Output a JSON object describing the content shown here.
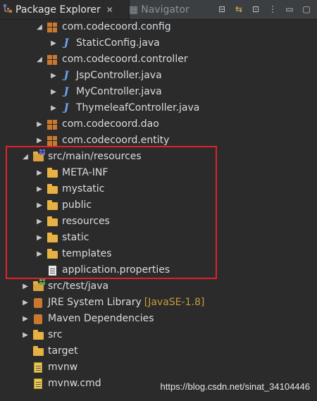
{
  "tabs": {
    "active": {
      "label": "Package Explorer"
    },
    "inactive": {
      "label": "Navigator"
    }
  },
  "toolbar": {
    "buttons": [
      "collapse-all-icon",
      "link-with-editor-icon",
      "focus-icon",
      "view-menu-icon",
      "minimize-icon",
      "maximize-icon"
    ]
  },
  "tree": [
    {
      "label": "com.codecoord.config",
      "type": "package",
      "expanded": true,
      "indent": 2
    },
    {
      "label": "StaticConfig.java",
      "type": "java",
      "expanded": false,
      "indent": 3
    },
    {
      "label": "com.codecoord.controller",
      "type": "package",
      "expanded": true,
      "indent": 2
    },
    {
      "label": "JspController.java",
      "type": "java",
      "expanded": false,
      "indent": 3
    },
    {
      "label": "MyController.java",
      "type": "java",
      "expanded": false,
      "indent": 3
    },
    {
      "label": "ThymeleafController.java",
      "type": "java",
      "expanded": false,
      "indent": 3
    },
    {
      "label": "com.codecoord.dao",
      "type": "package",
      "expanded": false,
      "indent": 2
    },
    {
      "label": "com.codecoord.entity",
      "type": "package",
      "expanded": false,
      "indent": 2
    },
    {
      "label": "src/main/resources",
      "type": "srcfolder",
      "expanded": true,
      "indent": 1
    },
    {
      "label": "META-INF",
      "type": "folder",
      "expanded": false,
      "indent": 2
    },
    {
      "label": "mystatic",
      "type": "folder",
      "expanded": false,
      "indent": 2
    },
    {
      "label": "public",
      "type": "folder",
      "expanded": false,
      "indent": 2
    },
    {
      "label": "resources",
      "type": "folder",
      "expanded": false,
      "indent": 2
    },
    {
      "label": "static",
      "type": "folder",
      "expanded": false,
      "indent": 2
    },
    {
      "label": "templates",
      "type": "folder",
      "expanded": false,
      "indent": 2
    },
    {
      "label": "application.properties",
      "type": "file",
      "expanded": false,
      "indent": 2
    },
    {
      "label": "src/test/java",
      "type": "srcfolder-green",
      "expanded": false,
      "indent": 1
    },
    {
      "label": "JRE System Library",
      "suffix": "[JavaSE-1.8]",
      "type": "library",
      "expanded": false,
      "indent": 1
    },
    {
      "label": "Maven Dependencies",
      "type": "library",
      "expanded": false,
      "indent": 1
    },
    {
      "label": "src",
      "type": "folder",
      "expanded": false,
      "indent": 1
    },
    {
      "label": "target",
      "type": "folder",
      "expanded": false,
      "indent": 1
    },
    {
      "label": "mvnw",
      "type": "textfile",
      "expanded": false,
      "indent": 1
    },
    {
      "label": "mvnw.cmd",
      "type": "textfile",
      "expanded": false,
      "indent": 1
    }
  ],
  "watermark": "https://blog.csdn.net/sinat_34104446",
  "colors": {
    "background": "#2b2b2b",
    "highlight_border": "#e0212a",
    "package_icon": "#c8782f",
    "java_icon": "#6ea7f5",
    "folder_icon": "#e8b143",
    "library_suffix": "#c79a3c"
  }
}
